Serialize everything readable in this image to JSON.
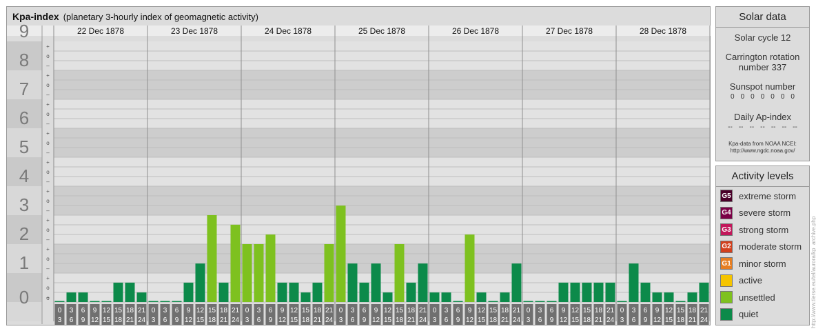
{
  "title": "Kpa-index",
  "subtitle": "(planetary 3-hourly index of geomagnetic activity)",
  "chart_data": {
    "type": "bar",
    "ylim": [
      0,
      9
    ],
    "y_major_ticks": [
      "0",
      "1",
      "2",
      "3",
      "4",
      "5",
      "6",
      "7",
      "8",
      "9"
    ],
    "y_minor_marks": [
      "–",
      "o",
      "+"
    ],
    "days": [
      "22 Dec 1878",
      "23 Dec 1878",
      "24 Dec 1878",
      "25 Dec 1878",
      "26 Dec 1878",
      "27 Dec 1878",
      "28 Dec 1878"
    ],
    "interval_top": [
      "0",
      "3",
      "6",
      "9",
      "12",
      "15",
      "18",
      "21"
    ],
    "interval_bottom": [
      "3",
      "6",
      "9",
      "12",
      "15",
      "18",
      "21",
      "24"
    ],
    "series": [
      {
        "values": [
          0.0,
          0.33,
          0.33,
          0.0,
          0.0,
          0.67,
          0.67,
          0.33,
          0.0,
          0.0,
          0.0,
          0.67,
          1.33,
          3.0,
          0.67,
          2.67,
          2.0,
          2.0,
          2.33,
          0.67,
          0.67,
          0.33,
          0.67,
          2.0,
          3.33,
          1.33,
          0.67,
          1.33,
          0.33,
          2.0,
          0.67,
          1.33,
          0.33,
          0.33,
          0.0,
          2.33,
          0.33,
          0.0,
          0.33,
          1.33,
          0.0,
          0.0,
          0.0,
          0.67,
          0.67,
          0.67,
          0.67,
          0.67,
          0.0,
          1.33,
          0.67,
          0.33,
          0.33,
          0.0,
          0.33,
          0.67
        ]
      }
    ]
  },
  "colors": {
    "quiet": "#0c8a4a",
    "unsettled": "#7ec11f",
    "active": "#f5c400",
    "g1": "#e67e22",
    "g2": "#d2401d",
    "g3": "#c2185b",
    "g4": "#7b0046",
    "g5": "#4a0029",
    "band_dark": "#cdcdcd",
    "band_light": "#e2e2e2",
    "label_bg": "#707070"
  },
  "solar": {
    "heading": "Solar data",
    "cycle": "Solar cycle 12",
    "carrington_1": "Carrington rotation",
    "carrington_2": "number 337",
    "sunspot_label": "Sunspot number",
    "sunspot_values": [
      "0",
      "0",
      "0",
      "0",
      "0",
      "0",
      "0"
    ],
    "ap_label": "Daily Ap-index",
    "ap_values": [
      "--",
      "--",
      "--",
      "--",
      "--",
      "--",
      "--"
    ],
    "source_1": "Kpa-data from NOAA NCEI:",
    "source_2": "http://www.ngdc.noaa.gov/"
  },
  "activity": {
    "heading": "Activity levels",
    "levels": [
      {
        "code": "G5",
        "label": "extreme storm",
        "color": "#4a0029"
      },
      {
        "code": "G4",
        "label": "severe storm",
        "color": "#7b0046"
      },
      {
        "code": "G3",
        "label": "strong storm",
        "color": "#c2185b"
      },
      {
        "code": "G2",
        "label": "moderate storm",
        "color": "#d2401d"
      },
      {
        "code": "G1",
        "label": "minor storm",
        "color": "#e67e22"
      },
      {
        "code": "",
        "label": "active",
        "color": "#f5c400"
      },
      {
        "code": "",
        "label": "unsettled",
        "color": "#7ec11f"
      },
      {
        "code": "",
        "label": "quiet",
        "color": "#0c8a4a"
      }
    ]
  },
  "watermark": "http://www.tierse.eu/tel/aurora/kp_archive.php"
}
